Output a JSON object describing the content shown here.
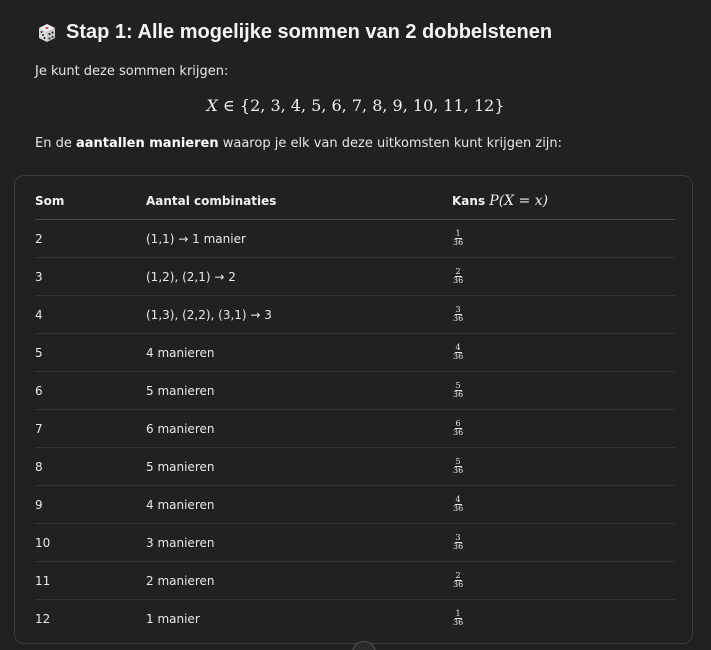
{
  "heading": {
    "emoji_icon": "game-die-icon",
    "title": "Stap 1: Alle mogelijke sommen van 2 dobbelstenen"
  },
  "intro": "Je kunt deze sommen krijgen:",
  "set_expression": {
    "variable": "X",
    "relation": "∈",
    "values": "{2, 3, 4, 5, 6, 7, 8, 9, 10, 11, 12}"
  },
  "description": {
    "prefix": "En de ",
    "bold": "aantallen manieren",
    "suffix": " waarop je elk van deze uitkomsten kunt krijgen zijn:"
  },
  "table": {
    "headers": {
      "som": "Som",
      "combinations": "Aantal combinaties",
      "kans_label": "Kans",
      "kans_symbol": "P(X = x)"
    },
    "rows": [
      {
        "som": "2",
        "combinations": "(1,1) → 1 manier",
        "numerator": "1",
        "denominator": "36"
      },
      {
        "som": "3",
        "combinations": "(1,2), (2,1) → 2",
        "numerator": "2",
        "denominator": "36"
      },
      {
        "som": "4",
        "combinations": "(1,3), (2,2), (3,1) → 3",
        "numerator": "3",
        "denominator": "36"
      },
      {
        "som": "5",
        "combinations": "4 manieren",
        "numerator": "4",
        "denominator": "36"
      },
      {
        "som": "6",
        "combinations": "5 manieren",
        "numerator": "5",
        "denominator": "36"
      },
      {
        "som": "7",
        "combinations": "6 manieren",
        "numerator": "6",
        "denominator": "36"
      },
      {
        "som": "8",
        "combinations": "5 manieren",
        "numerator": "5",
        "denominator": "36"
      },
      {
        "som": "9",
        "combinations": "4 manieren",
        "numerator": "4",
        "denominator": "36"
      },
      {
        "som": "10",
        "combinations": "3 manieren",
        "numerator": "3",
        "denominator": "36"
      },
      {
        "som": "11",
        "combinations": "2 manieren",
        "numerator": "2",
        "denominator": "36"
      },
      {
        "som": "12",
        "combinations": "1 manier",
        "numerator": "1",
        "denominator": "36"
      }
    ]
  },
  "scroll_button_icon": "scroll-down-icon"
}
